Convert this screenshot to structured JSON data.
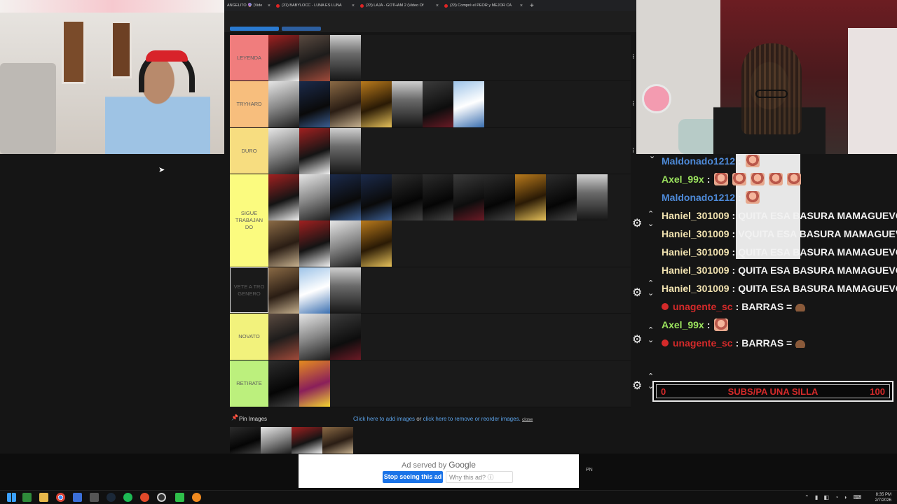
{
  "browser": {
    "tabs": [
      {
        "label": "ANGELITO 🔮 (Vide"
      },
      {
        "label": "(31) BABYLOCC - LUNA ES LUNA"
      },
      {
        "label": "(33) LAJA - GOTHAM 2 (Video Of"
      },
      {
        "label": "(33) Compré el PEOR y MEJOR CA"
      }
    ],
    "new_tab": "+"
  },
  "tiers": [
    {
      "label": "LEYENDA",
      "color": "#f07d7d",
      "count": 3
    },
    {
      "label": "TRYHARD",
      "color": "#f7be7d",
      "count": 7
    },
    {
      "label": "DURO",
      "color": "#f7dd80",
      "count": 3
    },
    {
      "label": "SIGUE TRABAJAN DO",
      "color": "#fbfb7f",
      "count": 15
    },
    {
      "label": "VETE A TRO GENERO",
      "color": "#1a1a1a",
      "count": 3
    },
    {
      "label": "NOVATO",
      "color": "#f2f27c",
      "count": 3
    },
    {
      "label": "RETIRATE",
      "color": "#bcf07d",
      "count": 2
    }
  ],
  "chat": {
    "lines": [
      {
        "user": "Maldonado1212",
        "sep": " :",
        "msg": "",
        "color": "blue",
        "emotes": 1
      },
      {
        "user": "Axel_99x",
        "sep": " :",
        "msg": "",
        "color": "green",
        "emotes": 5
      },
      {
        "user": "Maldonado1212",
        "sep": " :",
        "msg": "",
        "color": "blue",
        "emotes": 1
      },
      {
        "user": "Haniel_301009",
        "sep": " :",
        "msg": "QUITA ESA BASURA MAMAGUEVO",
        "color": "gold"
      },
      {
        "user": "Haniel_301009",
        "sep": " :",
        "msg": "VQUITA ESA BASURA MAMAGUEVO",
        "color": "gold"
      },
      {
        "user": "Haniel_301009",
        "sep": " :",
        "msg": "QUITA ESA BASURA MAMAGUEVO",
        "color": "gold"
      },
      {
        "user": "Haniel_301009",
        "sep": " :",
        "msg": "QUITA ESA BASURA MAMAGUEVO",
        "color": "gold"
      },
      {
        "user": "Haniel_301009",
        "sep": " :",
        "msg": "QUITA ESA BASURA MAMAGUEVO",
        "color": "gold"
      },
      {
        "user": "unagente_sc",
        "sep": " :",
        "msg": "BARRAS =",
        "color": "red"
      },
      {
        "user": "Axel_99x",
        "sep": " :",
        "msg": "",
        "color": "green",
        "emotes": 1
      },
      {
        "user": "unagente_sc",
        "sep": " :",
        "msg": "BARRAS =",
        "color": "red"
      }
    ]
  },
  "sub_goal": {
    "start": "0",
    "label": "SUBS/PA UNA SILLA",
    "end": "100"
  },
  "pin": {
    "label": "Pin Images",
    "add_link": "Click here to add images",
    "or": "or",
    "remove_link": "click here to remove or reorder images.",
    "close": "close"
  },
  "ad": {
    "served_by": "Ad served by",
    "brand": "Google",
    "stop": "Stop seeing this ad",
    "why": "Why this ad? ⓘ",
    "side": "PN"
  },
  "taskbar": {
    "time": "8:35 PM",
    "date": "2/7/2026"
  }
}
